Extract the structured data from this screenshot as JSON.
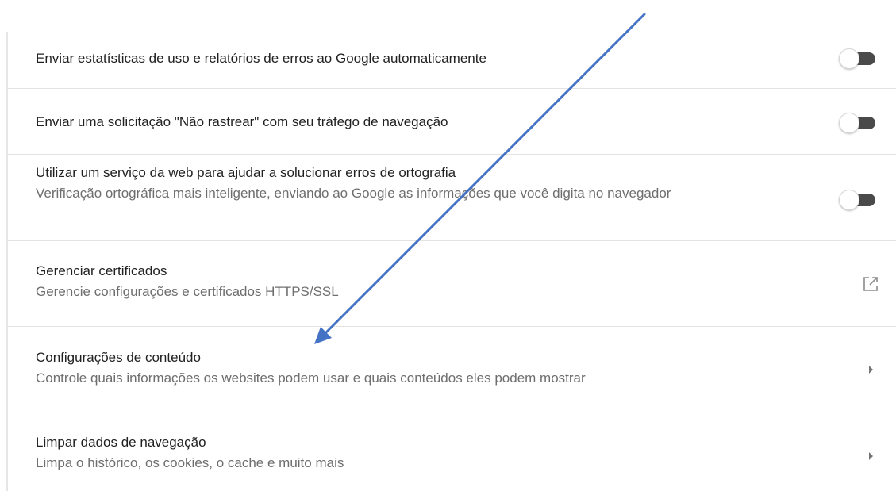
{
  "settings": {
    "items": [
      {
        "title": "Enviar estatísticas de uso e relatórios de erros ao Google automaticamente",
        "description": "",
        "control": "toggle",
        "enabled": false
      },
      {
        "title": "Enviar uma solicitação \"Não rastrear\" com seu tráfego de navegação",
        "description": "",
        "control": "toggle",
        "enabled": false
      },
      {
        "title": "Utilizar um serviço da web para ajudar a solucionar erros de ortografia",
        "description": "Verificação ortográfica mais inteligente, enviando ao Google as informações que você digita no navegador",
        "control": "toggle",
        "enabled": false
      },
      {
        "title": "Gerenciar certificados",
        "description": "Gerencie configurações e certificados HTTPS/SSL",
        "control": "external-link-icon"
      },
      {
        "title": "Configurações de conteúdo",
        "description": "Controle quais informações os websites podem usar e quais conteúdos eles podem mostrar",
        "control": "chevron-right-icon"
      },
      {
        "title": "Limpar dados de navegação",
        "description": "Limpa o histórico, os cookies, o cache e muito mais",
        "control": "chevron-right-icon"
      }
    ]
  },
  "colors": {
    "toggle_track": "#4a4a4a",
    "divider": "#e3e3e3",
    "annotation_arrow": "#4472c4"
  }
}
